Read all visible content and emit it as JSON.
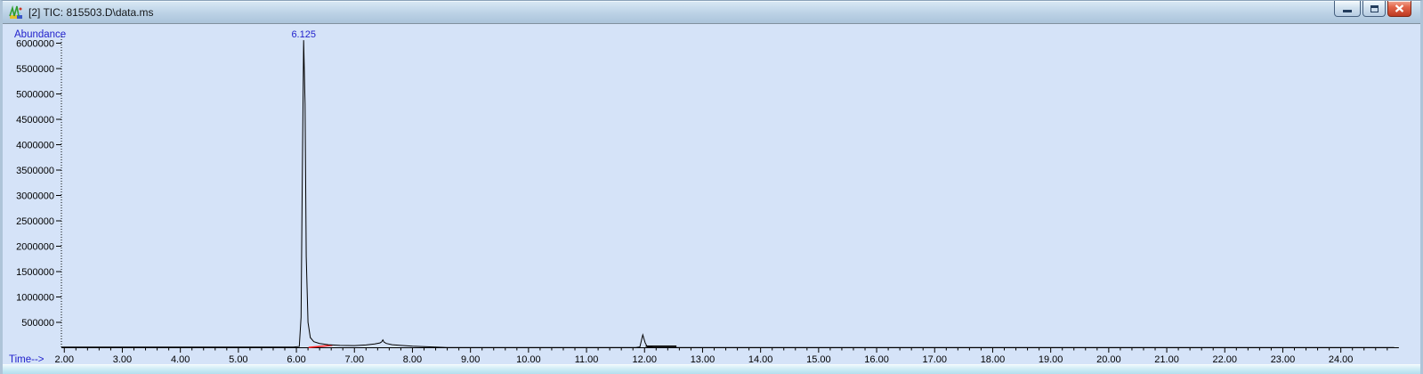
{
  "window": {
    "title": "[2] TIC: 815503.D\\data.ms",
    "icon": "chromatogram-app-icon",
    "controls": [
      {
        "name": "minimize"
      },
      {
        "name": "restore"
      },
      {
        "name": "close"
      }
    ]
  },
  "chart_data": {
    "type": "line",
    "title": "TIC: 815503.D\\data.ms",
    "xlabel": "Time-->",
    "ylabel": "Abundance",
    "xlim": [
      1.95,
      25.0
    ],
    "ylim": [
      0,
      6150000
    ],
    "grid": false,
    "x_tick_labels": [
      "2.00",
      "3.00",
      "4.00",
      "5.00",
      "6.00",
      "7.00",
      "8.00",
      "9.00",
      "10.00",
      "11.00",
      "12.00",
      "13.00",
      "14.00",
      "15.00",
      "16.00",
      "17.00",
      "18.00",
      "19.00",
      "20.00",
      "21.00",
      "22.00",
      "23.00",
      "24.00"
    ],
    "x_minor_step": 0.2,
    "y_tick_labels": [
      "500000",
      "1000000",
      "1500000",
      "2000000",
      "2500000",
      "3000000",
      "3500000",
      "4000000",
      "4500000",
      "5000000",
      "5500000",
      "6000000"
    ],
    "peak_labels": [
      {
        "label": "6.125",
        "t": 6.125,
        "abundance": 6060000
      }
    ],
    "series": [
      {
        "name": "TIC",
        "color": "#000000",
        "points": [
          [
            1.95,
            12000
          ],
          [
            5.95,
            12000
          ],
          [
            6.05,
            25000
          ],
          [
            6.08,
            600000
          ],
          [
            6.1,
            3200000
          ],
          [
            6.125,
            6060000
          ],
          [
            6.15,
            4800000
          ],
          [
            6.17,
            1800000
          ],
          [
            6.2,
            500000
          ],
          [
            6.24,
            200000
          ],
          [
            6.3,
            120000
          ],
          [
            6.4,
            85000
          ],
          [
            6.55,
            60000
          ],
          [
            6.75,
            45000
          ],
          [
            7.0,
            42000
          ],
          [
            7.2,
            55000
          ],
          [
            7.35,
            75000
          ],
          [
            7.44,
            95000
          ],
          [
            7.47,
            115000
          ],
          [
            7.49,
            155000
          ],
          [
            7.51,
            110000
          ],
          [
            7.55,
            85000
          ],
          [
            7.65,
            60000
          ],
          [
            7.8,
            45000
          ],
          [
            8.0,
            32000
          ],
          [
            8.2,
            22000
          ],
          [
            8.4,
            12000
          ],
          [
            8.6,
            5000
          ],
          [
            9.0,
            3000
          ],
          [
            11.85,
            3000
          ],
          [
            11.92,
            15000
          ],
          [
            11.97,
            255000
          ],
          [
            12.01,
            100000
          ],
          [
            12.05,
            12000
          ],
          [
            12.15,
            4000
          ],
          [
            24.92,
            3000
          ]
        ]
      }
    ],
    "integration_markers": [
      {
        "color": "#ff2222",
        "from": [
          6.21,
          5000
        ],
        "to": [
          6.62,
          48000
        ]
      },
      {
        "color": "#000000",
        "from": [
          12.02,
          30000
        ],
        "to": [
          12.55,
          30000
        ]
      }
    ],
    "colors": {
      "axis_label_blue": "#2222cc",
      "tick_text": "#000000",
      "background": "#d5e3f8"
    }
  }
}
